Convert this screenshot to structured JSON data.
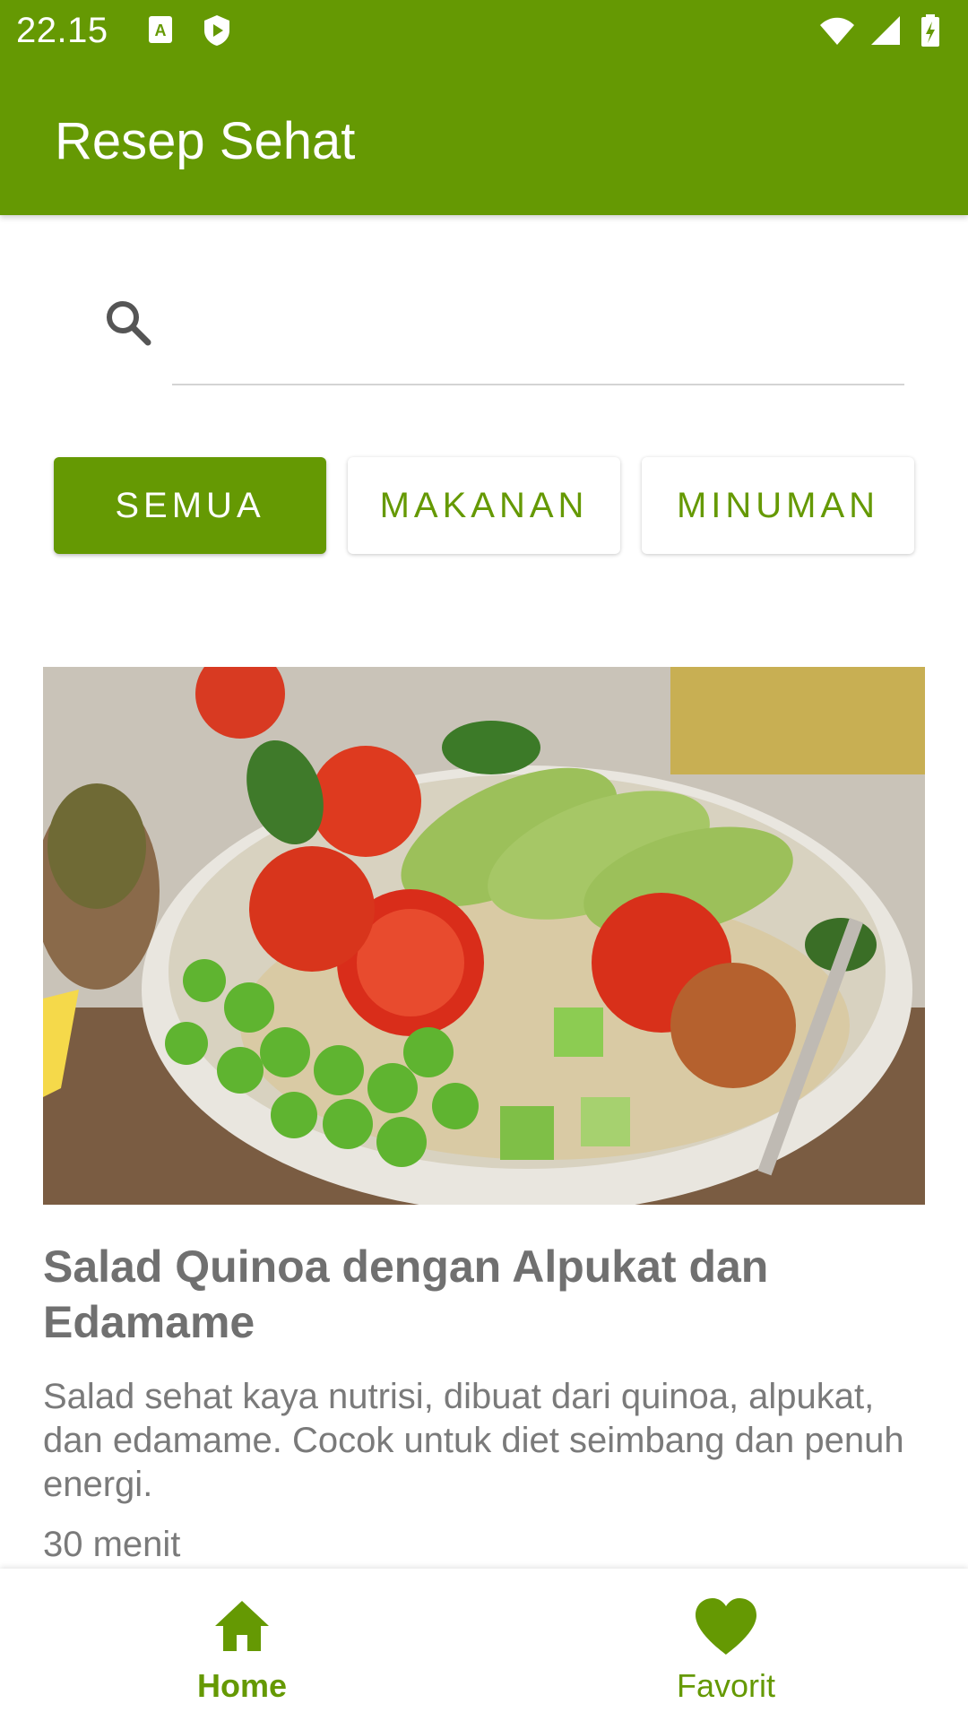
{
  "status_bar": {
    "time": "22.15",
    "left_icons": [
      "a-notification-icon",
      "shield-play-icon"
    ],
    "right_icons": [
      "wifi-icon",
      "signal-icon",
      "battery-charging-icon"
    ]
  },
  "app_bar": {
    "title": "Resep Sehat"
  },
  "search": {
    "placeholder": "",
    "value": ""
  },
  "filters": [
    {
      "label": "SEMUA",
      "active": true
    },
    {
      "label": "MAKANAN",
      "active": false
    },
    {
      "label": "MINUMAN",
      "active": false
    }
  ],
  "recipes": [
    {
      "title": "Salad Quinoa dengan Alpukat dan Edamame",
      "description": "Salad sehat kaya nutrisi, dibuat dari quinoa, alpukat, dan edamame. Cocok untuk diet seimbang dan penuh energi.",
      "time": "30 menit"
    }
  ],
  "bottom_nav": [
    {
      "label": "Home",
      "icon": "home-icon",
      "active": true
    },
    {
      "label": "Favorit",
      "icon": "heart-icon",
      "active": false
    }
  ],
  "colors": {
    "primary": "#659903",
    "text_muted": "#757575"
  }
}
